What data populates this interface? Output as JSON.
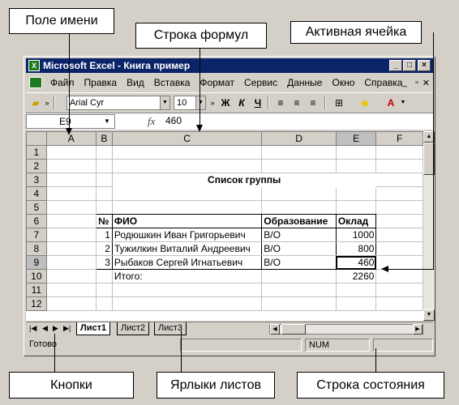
{
  "callouts": {
    "name_box": "Поле имени",
    "formula_bar": "Строка формул",
    "active_cell": "Активная ячейка",
    "buttons": "Кнопки",
    "sheet_tabs": "Ярлыки листов",
    "status_bar": "Строка  состояния"
  },
  "window": {
    "title": "Microsoft Excel - Книга пример"
  },
  "menu": [
    "Файл",
    "Правка",
    "Вид",
    "Вставка",
    "Формат",
    "Сервис",
    "Данные",
    "Окно",
    "Справка"
  ],
  "toolbar": {
    "font": "Arial Cyr",
    "size": "10",
    "bold": "Ж",
    "italic": "К",
    "underline": "Ч"
  },
  "formula_bar": {
    "cell_ref": "E9",
    "fx": "fx",
    "value": "460"
  },
  "sheet": {
    "columns": [
      "A",
      "B",
      "C",
      "D",
      "E",
      "F"
    ],
    "rows": [
      "1",
      "2",
      "3",
      "4",
      "5",
      "6",
      "7",
      "8",
      "9",
      "10",
      "11",
      "12"
    ],
    "title": "Список группы",
    "headers": {
      "num": "№",
      "name": "ФИО",
      "edu": "Образование",
      "salary": "Оклад"
    },
    "records": [
      {
        "num": "1",
        "name": "Родюшкин Иван Григорьевич",
        "edu": "В/О",
        "salary": "1000"
      },
      {
        "num": "2",
        "name": "Тужилкин Виталий Андреевич",
        "edu": "В/О",
        "salary": "800"
      },
      {
        "num": "3",
        "name": "Рыбаков Сергей Игнатьевич",
        "edu": "В/О",
        "salary": "460"
      }
    ],
    "total_label": "Итого:",
    "total_value": "2260"
  },
  "tabs": [
    "Лист1",
    "Лист2",
    "Лист3"
  ],
  "status": {
    "ready": "Готово",
    "num": "NUM"
  }
}
